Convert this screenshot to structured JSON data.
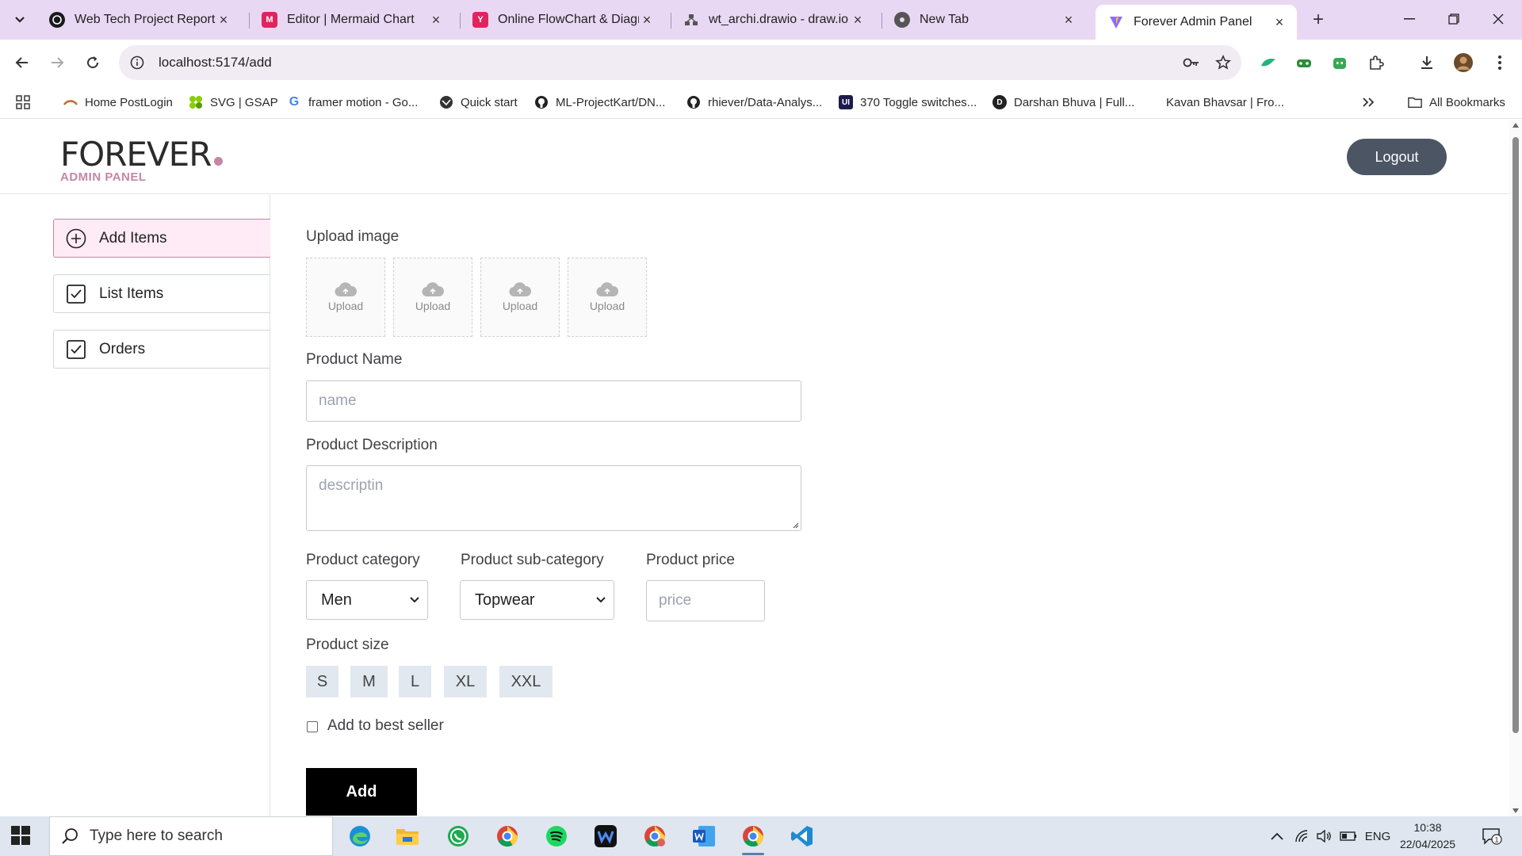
{
  "browser": {
    "tabs": [
      {
        "title": "Web Tech Project Report",
        "icon": "chatgpt-icon"
      },
      {
        "title": "Editor | Mermaid Chart",
        "icon": "mermaid-icon"
      },
      {
        "title": "Online FlowChart & Diagra",
        "icon": "flowchart-icon"
      },
      {
        "title": "wt_archi.drawio - draw.io",
        "icon": "drawio-icon"
      },
      {
        "title": "New Tab",
        "icon": "chrome-icon"
      },
      {
        "title": "Forever Admin Panel",
        "icon": "vite-icon"
      }
    ],
    "url": "localhost:5174/add",
    "bookmarks": [
      {
        "label": "Home PostLogin"
      },
      {
        "label": "SVG | GSAP"
      },
      {
        "label": "framer motion - Go..."
      },
      {
        "label": "Quick start"
      },
      {
        "label": "ML-ProjectKart/DN..."
      },
      {
        "label": "rhiever/Data-Analys..."
      },
      {
        "label": "370 Toggle switches..."
      },
      {
        "label": "Darshan Bhuva | Full..."
      },
      {
        "label": "Kavan Bhavsar | Fro..."
      }
    ],
    "all_bookmarks": "All Bookmarks"
  },
  "header": {
    "logo": "FOREVER",
    "logo_sub": "ADMIN PANEL",
    "logout": "Logout"
  },
  "sidebar": {
    "items": [
      {
        "label": "Add Items"
      },
      {
        "label": "List Items"
      },
      {
        "label": "Orders"
      }
    ]
  },
  "form": {
    "upload_label": "Upload image",
    "upload_text": "Upload",
    "name_label": "Product Name",
    "name_placeholder": "name",
    "desc_label": "Product Description",
    "desc_placeholder": "descriptin",
    "category_label": "Product category",
    "category_value": "Men",
    "subcategory_label": "Product sub-category",
    "subcategory_value": "Topwear",
    "price_label": "Product price",
    "price_placeholder": "price",
    "size_label": "Product size",
    "sizes": [
      "S",
      "M",
      "L",
      "XL",
      "XXL"
    ],
    "bestseller_label": "Add to best seller",
    "submit": "Add"
  },
  "taskbar": {
    "search_placeholder": "Type here to search",
    "language": "ENG",
    "time": "10:38",
    "date": "22/04/2025",
    "notifications": "1"
  },
  "colors": {
    "accent_pink": "#c586a5",
    "active_bg": "#ffebf5",
    "logout_bg": "#4b5563",
    "tabbar_bg": "#e9d8f3"
  }
}
